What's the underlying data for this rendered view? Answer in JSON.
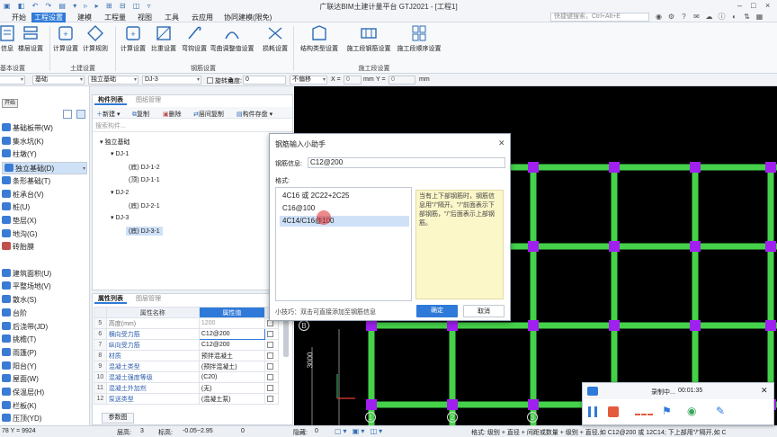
{
  "window": {
    "title": "广联达BIM土建计量平台 GTJ2021 - [工程1]",
    "controls": [
      "–",
      "□",
      "×"
    ]
  },
  "menu": {
    "items": [
      "开始",
      "工程设置",
      "建模",
      "工程量",
      "视图",
      "工具",
      "云应用",
      "协同建模(限免)"
    ],
    "active_index": 1,
    "search_placeholder": "快捷键搜索，Ctrl+Alt+E"
  },
  "ribbon": {
    "buttons": [
      {
        "label": "信息",
        "icon": "info-icon"
      },
      {
        "label": "楼层设置",
        "icon": "floor-settings-icon"
      },
      {
        "label": "计算设置",
        "icon": "calc-settings-icon"
      },
      {
        "label": "计算规则",
        "icon": "calc-rules-icon"
      },
      {
        "label": "计算设置",
        "icon": "calc-settings-2-icon"
      },
      {
        "label": "比重设置",
        "icon": "density-icon"
      },
      {
        "label": "弯钩设置",
        "icon": "hook-icon"
      },
      {
        "label": "弯曲调整值设置",
        "icon": "bend-adjust-icon"
      },
      {
        "label": "损耗设置",
        "icon": "loss-icon"
      },
      {
        "label": "结构类型设置",
        "icon": "structure-type-icon"
      },
      {
        "label": "施工段钢筋设置",
        "icon": "segment-rebar-icon"
      },
      {
        "label": "施工段顺序设置",
        "icon": "segment-order-icon"
      }
    ],
    "groups": [
      "基本设置",
      "土建设置",
      "钢筋设置",
      "施工段设置"
    ]
  },
  "selector_bar": {
    "select1": "",
    "select2": "基础",
    "select3": "独立基础",
    "select4": "DJ-3",
    "rotate_label": "旋转点",
    "angle_label": "角度:",
    "angle_value": "0",
    "offset_select": "不偏移",
    "x_label": "X =",
    "x_value": "0",
    "unit1": "mm",
    "y_label": "Y =",
    "y_value": "0",
    "unit2": "mm"
  },
  "left_nav": {
    "tooltip": "开始",
    "items": [
      {
        "label": "基础板带(W)",
        "color": "#3a7bd5"
      },
      {
        "label": "集水坑(K)",
        "color": "#3a7bd5"
      },
      {
        "label": "柱墩(Y)",
        "color": "#3a7bd5"
      },
      {
        "label": "独立基础(D)",
        "color": "#3a7bd5",
        "selected": true
      },
      {
        "label": "条形基础(T)",
        "color": "#3a7bd5"
      },
      {
        "label": "桩承台(V)",
        "color": "#3a7bd5"
      },
      {
        "label": "桩(U)",
        "color": "#3a7bd5"
      },
      {
        "label": "垫层(X)",
        "color": "#3a7bd5"
      },
      {
        "label": "地沟(G)",
        "color": "#3a7bd5"
      },
      {
        "label": "砖胎膜",
        "color": "#c0504d"
      },
      {
        "label": "",
        "color": ""
      },
      {
        "label": "建筑面积(U)",
        "color": "#3a7bd5"
      },
      {
        "label": "平整场地(V)",
        "color": "#3a7bd5"
      },
      {
        "label": "散水(S)",
        "color": "#3a7bd5"
      },
      {
        "label": "台阶",
        "color": "#3a7bd5"
      },
      {
        "label": "后浇带(JD)",
        "color": "#3a7bd5"
      },
      {
        "label": "挑檐(T)",
        "color": "#3a7bd5"
      },
      {
        "label": "雨篷(P)",
        "color": "#3a7bd5"
      },
      {
        "label": "阳台(Y)",
        "color": "#3a7bd5"
      },
      {
        "label": "屋面(W)",
        "color": "#3a7bd5"
      },
      {
        "label": "保温层(H)",
        "color": "#3a7bd5"
      },
      {
        "label": "栏板(K)",
        "color": "#3a7bd5"
      },
      {
        "label": "压顶(YD)",
        "color": "#3a7bd5"
      }
    ]
  },
  "component_panel": {
    "tabs": [
      "构件列表",
      "图纸管理"
    ],
    "toolbar": [
      "新建",
      "复制",
      "删除",
      "层间复制",
      "构件存盘"
    ],
    "search_placeholder": "搜索构件...",
    "tree": [
      {
        "label": "独立基础",
        "level": 0
      },
      {
        "label": "DJ-1",
        "level": 1
      },
      {
        "label": "(底) DJ-1-2",
        "level": 2
      },
      {
        "label": "(顶) DJ-1-1",
        "level": 2
      },
      {
        "label": "DJ-2",
        "level": 1
      },
      {
        "label": "(底) DJ-2-1",
        "level": 2
      },
      {
        "label": "DJ-3",
        "level": 1
      },
      {
        "label": "(底) DJ-3-1",
        "level": 2,
        "selected": true
      }
    ]
  },
  "property_panel": {
    "tabs": [
      "属性列表",
      "图层管理"
    ],
    "headers": [
      "属性名称",
      "属性值",
      "附"
    ],
    "rows": [
      {
        "n": "5",
        "name": "高度(mm)",
        "value": "1200",
        "gray": true
      },
      {
        "n": "6",
        "name": "横向受力筋",
        "value": "C12@200",
        "current": true
      },
      {
        "n": "7",
        "name": "纵向受力筋",
        "value": "C12@200"
      },
      {
        "n": "8",
        "name": "材质",
        "value": "预拌混凝土"
      },
      {
        "n": "9",
        "name": "混凝土类型",
        "value": "(预拌混凝土)"
      },
      {
        "n": "10",
        "name": "混凝土强度等级",
        "value": "(C20)"
      },
      {
        "n": "11",
        "name": "混凝土外加剂",
        "value": "(无)"
      },
      {
        "n": "12",
        "name": "泵送类型",
        "value": "(混凝土泵)"
      }
    ],
    "footer_button": "参数图"
  },
  "canvas": {
    "axis_label_b": "B",
    "dimension": "3000",
    "axis_numbers": [
      "1",
      "2",
      "3"
    ],
    "grid_color": "#45d14a",
    "node_color": "#a020f0"
  },
  "dialog": {
    "title": "钢筋输入小助手",
    "rebar_label": "钢筋信息:",
    "rebar_value": "C12@200",
    "format_label": "格式:",
    "formats": [
      "4C16 或 2C22+2C25",
      "C16@100",
      "4C14/C16@100"
    ],
    "selected_format_index": 2,
    "hint": "当有上下部钢筋时，钢筋信息用\"/\"隔开。\"/\"前面表示下部钢筋，\"/\"后面表示上部钢筋。",
    "tip": "小技巧：双击可直接添加至钢筋信息",
    "ok": "确定",
    "cancel": "取消"
  },
  "status_bar": {
    "coords": "78 Y = 9924",
    "floor_label": "层高:",
    "floor_value": "3",
    "elev_label": "标高:",
    "elev_value": "-0.05~2.95",
    "count": "0",
    "hidden_label": "隐藏:",
    "hidden_value": "0",
    "format_hint": "格式: 级别 + 直径 + 间距或数量 + 级别 + 直径,如 C12@200 或 12C14; 下上部用\"/\"隔开,如 C"
  },
  "recorder": {
    "status": "录制中...",
    "time": "00:01:35"
  }
}
